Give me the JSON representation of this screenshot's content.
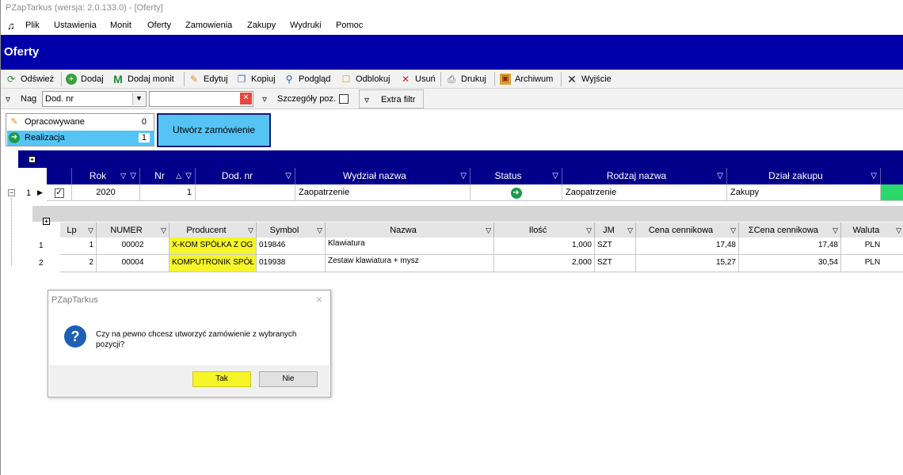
{
  "window": {
    "title": "PZapTarkus (wersja: 2.0.133.0) - [Oferty]"
  },
  "menu": [
    "Plik",
    "Ustawienia",
    "Monit",
    "Oferty",
    "Zamowienia",
    "Zakupy",
    "Wydruki",
    "Pomoc"
  ],
  "form_title": "Oferty",
  "toolbar": [
    {
      "label": "Odśwież",
      "icon": "refresh-icon"
    },
    {
      "label": "Dodaj",
      "icon": "add-icon"
    },
    {
      "label": "Dodaj monit",
      "icon": "m-icon"
    },
    {
      "label": "Edytuj",
      "icon": "pencil-icon"
    },
    {
      "label": "Kopiuj",
      "icon": "copy-icon"
    },
    {
      "label": "Podgląd",
      "icon": "magnifier-icon"
    },
    {
      "label": "Odblokuj",
      "icon": "unlock-icon"
    },
    {
      "label": "Usuń",
      "icon": "delete-icon"
    },
    {
      "label": "Drukuj",
      "icon": "printer-icon"
    },
    {
      "label": "Archiwum",
      "icon": "archive-icon"
    },
    {
      "label": "Wyjście",
      "icon": "exit-icon"
    }
  ],
  "filterbar": {
    "nag_label": "Nag",
    "combo_value": "Dod. nr",
    "filter_text": "",
    "details_label": "Szczegóły poz.",
    "details_checked": false,
    "extra_filter_label": "Extra filtr"
  },
  "status_panel": [
    {
      "label": "Opracowywane",
      "count": "0",
      "selected": false,
      "icon": "pencil-icon"
    },
    {
      "label": "Realizacja",
      "count": "1",
      "selected": true,
      "icon": "arrow-right-circle-icon"
    }
  ],
  "create_order_label": "Utwórz zamówienie",
  "main_grid": {
    "columns": [
      "Rok",
      "Nr",
      "Dod. nr",
      "Wydział nazwa",
      "Status",
      "Rodzaj nazwa",
      "Dział zakupu"
    ],
    "rows": [
      {
        "index": "1",
        "rok": "2020",
        "nr": "1",
        "dod_nr": "",
        "wydzial": "Zaopatrzenie",
        "status_icon": "arrow-right-circle-icon",
        "rodzaj": "Zaopatrzenie",
        "dzial": "Zakupy"
      }
    ]
  },
  "detail_grid": {
    "columns": [
      "Lp",
      "NUMER",
      "Producent",
      "Symbol",
      "Nazwa",
      "Ilość",
      "JM",
      "Cena cennikowa",
      "ΣCena cennikowa",
      "Waluta"
    ],
    "rows": [
      {
        "row": "1",
        "lp": "1",
        "numer": "00002",
        "producent": "X-KOM SPÓŁKA Z OG",
        "symbol": "019846",
        "nazwa": "Klawiatura",
        "ilosc": "1,000",
        "jm": "SZT",
        "cena": "17,48",
        "suma": "17,48",
        "waluta": "PLN"
      },
      {
        "row": "2",
        "lp": "2",
        "numer": "00004",
        "producent": "KOMPUTRONIK SPÓŁ",
        "symbol": "019938",
        "nazwa": "Zestaw klawiatura + mysz",
        "ilosc": "2,000",
        "jm": "SZT",
        "cena": "15,27",
        "suma": "30,54",
        "waluta": "PLN"
      }
    ]
  },
  "dialog": {
    "title": "PZapTarkus",
    "close": "×",
    "message": "Czy na pewno chcesz utworzyć zamówienie z wybranych pozycji?",
    "yes_label": "Tak",
    "no_label": "Nie"
  },
  "colors": {
    "header_blue": "#0000aa",
    "grid_header": "#00008b",
    "selection": "#55c4f5",
    "highlight": "#f5f52a",
    "status_green": "#1f9a4a"
  }
}
